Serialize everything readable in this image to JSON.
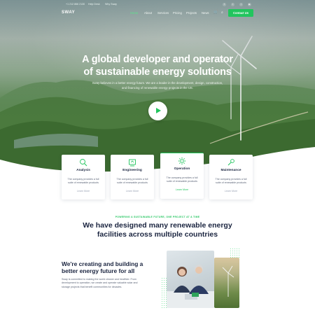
{
  "topbar": {
    "phone": "+1 212 866 2130",
    "help": "Help Desk",
    "location": "Why Sway",
    "social_icons": [
      "facebook-icon",
      "twitter-icon",
      "instagram-icon",
      "youtube-icon"
    ]
  },
  "nav": {
    "logo": "SWAY",
    "items": [
      {
        "label": "Home",
        "active": true
      },
      {
        "label": "About",
        "active": false
      },
      {
        "label": "Services",
        "active": false
      },
      {
        "label": "Pricing",
        "active": false
      },
      {
        "label": "Projects",
        "active": false
      },
      {
        "label": "News",
        "active": false
      }
    ],
    "cart_icon": "cart-icon",
    "search_icon": "search-icon",
    "contact_label": "Contact Us",
    "accent": "#22c55e"
  },
  "hero": {
    "title_line1": "A global developer and operator",
    "title_line2": "of sustainable energy solutions",
    "text": "Sway believes in a better energy future. We are a leader in the development, design, construction, and financing of renewable energy projects in the US.",
    "play_icon": "play-icon"
  },
  "cards": [
    {
      "title": "Analysis",
      "text": "The company provides a full suite of renewable products",
      "link": "Learn More",
      "icon": "analysis-icon"
    },
    {
      "title": "Engineering",
      "text": "The company provides a full suite of renewable products",
      "link": "Learn More",
      "icon": "engineering-icon"
    },
    {
      "title": "Operation",
      "text": "The company provides a full suite of renewable products",
      "link": "Learn More",
      "icon": "operation-icon"
    },
    {
      "title": "Maintenance",
      "text": "The company provides a full suite of renewable products",
      "link": "Learn More",
      "icon": "maintenance-icon"
    }
  ],
  "section": {
    "eyebrow": "POWERING A SUSTAINABLE FUTURE, ONE PROJECT AT A TIME",
    "title": "We have designed many renewable energy facilities across multiple countries"
  },
  "about": {
    "title": "We're creating and building a better energy future for all",
    "text": "Sway is committed to making the world cleaner and healthier. From development to operation, we create and operate valuable solar and storage projects that benefit communities for decades."
  }
}
